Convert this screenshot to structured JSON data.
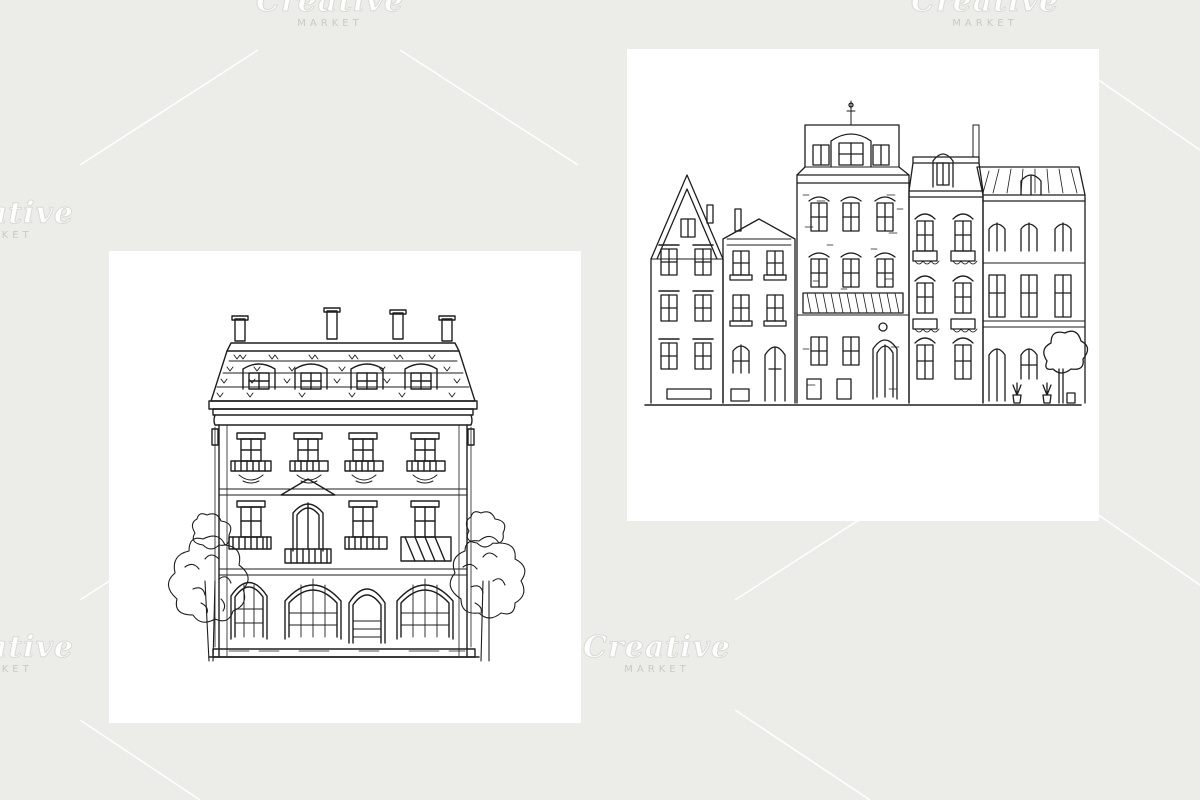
{
  "watermark": {
    "brand": "Creative",
    "sub": "MARKET"
  },
  "colors": {
    "background": "#ecede9",
    "card": "#ffffff",
    "ink": "#1e1e1e",
    "watermark_line": "#ffffff"
  },
  "illustrations": [
    {
      "kind": "single-townhouse-drawing"
    },
    {
      "kind": "row-of-townhouses-drawing"
    }
  ]
}
